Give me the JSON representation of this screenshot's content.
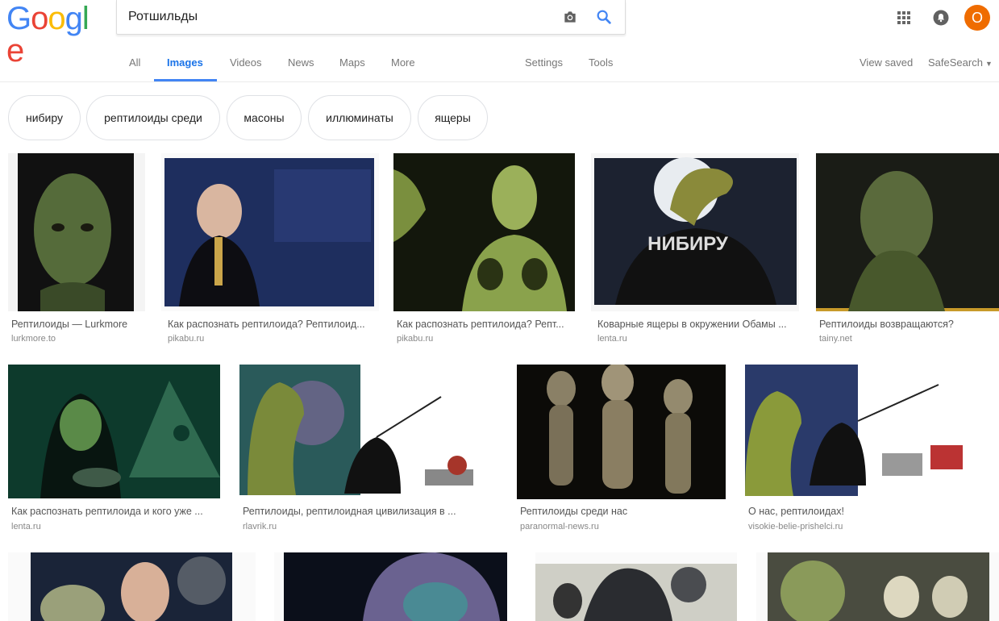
{
  "logo": {
    "letters": [
      "G",
      "o",
      "o",
      "g",
      "l",
      "e"
    ],
    "colors": [
      "#4285f4",
      "#ea4335",
      "#fbbc05",
      "#4285f4",
      "#34a853",
      "#ea4335"
    ]
  },
  "search": {
    "query": "Ротшильды"
  },
  "header": {
    "avatar_letter": "O",
    "avatar_color": "#ef6c00"
  },
  "tabs": [
    {
      "label": "All"
    },
    {
      "label": "Images",
      "active": true
    },
    {
      "label": "Videos"
    },
    {
      "label": "News"
    },
    {
      "label": "Maps"
    },
    {
      "label": "More"
    },
    {
      "label": "Settings"
    },
    {
      "label": "Tools"
    }
  ],
  "right_links": {
    "view_saved": "View saved",
    "safesearch": "SafeSearch"
  },
  "chips": [
    "нибиру",
    "рептилоиды среди",
    "масоны",
    "иллюминаты",
    "ящеры"
  ],
  "results": [
    {
      "caption": "Рептилоиды — Lurkmore",
      "domain": "lurkmore.to",
      "icon": "reptilian-face-image"
    },
    {
      "caption": "Как распознать рептилоида? Рептилоид...",
      "domain": "pikabu.ru",
      "icon": "man-in-suit-image"
    },
    {
      "caption": "Как распознать рептилоида? Репт...",
      "domain": "pikabu.ru",
      "icon": "green-lizard-woman-image"
    },
    {
      "caption": "Коварные ящеры в окружении Обамы ...",
      "domain": "lenta.ru",
      "icon": "snake-head-nibiru-shirt-image"
    },
    {
      "caption": "Рептилоиды возвращаются?",
      "domain": "tainy.net",
      "icon": "lizard-man-portrait-image"
    },
    {
      "caption": "Как распознать рептилоида и кого уже ...",
      "domain": "lenta.ru",
      "icon": "hooded-lizard-illuminati-image"
    },
    {
      "caption": "Рептилоиды, рептилоидная цивилизация в ...",
      "domain": "rlavrik.ru",
      "icon": "reptile-fishing-cartoon-image"
    },
    {
      "caption": "Рептилоиды среди нас",
      "domain": "paranormal-news.ru",
      "icon": "three-aliens-image"
    },
    {
      "caption": "О нас, рептилоидах!",
      "domain": "visokie-belie-prishelci.ru",
      "icon": "reptile-cartoon-image"
    },
    {
      "caption": "",
      "domain": "",
      "icon": "politician-alien-image"
    },
    {
      "caption": "",
      "domain": "",
      "icon": "hooded-reptile-space-image"
    },
    {
      "caption": "",
      "domain": "",
      "icon": "armored-reptiles-image"
    },
    {
      "caption": "",
      "domain": "",
      "icon": "reptile-warriors-image"
    }
  ],
  "nibiru_shirt_text": "НИБИРУ"
}
